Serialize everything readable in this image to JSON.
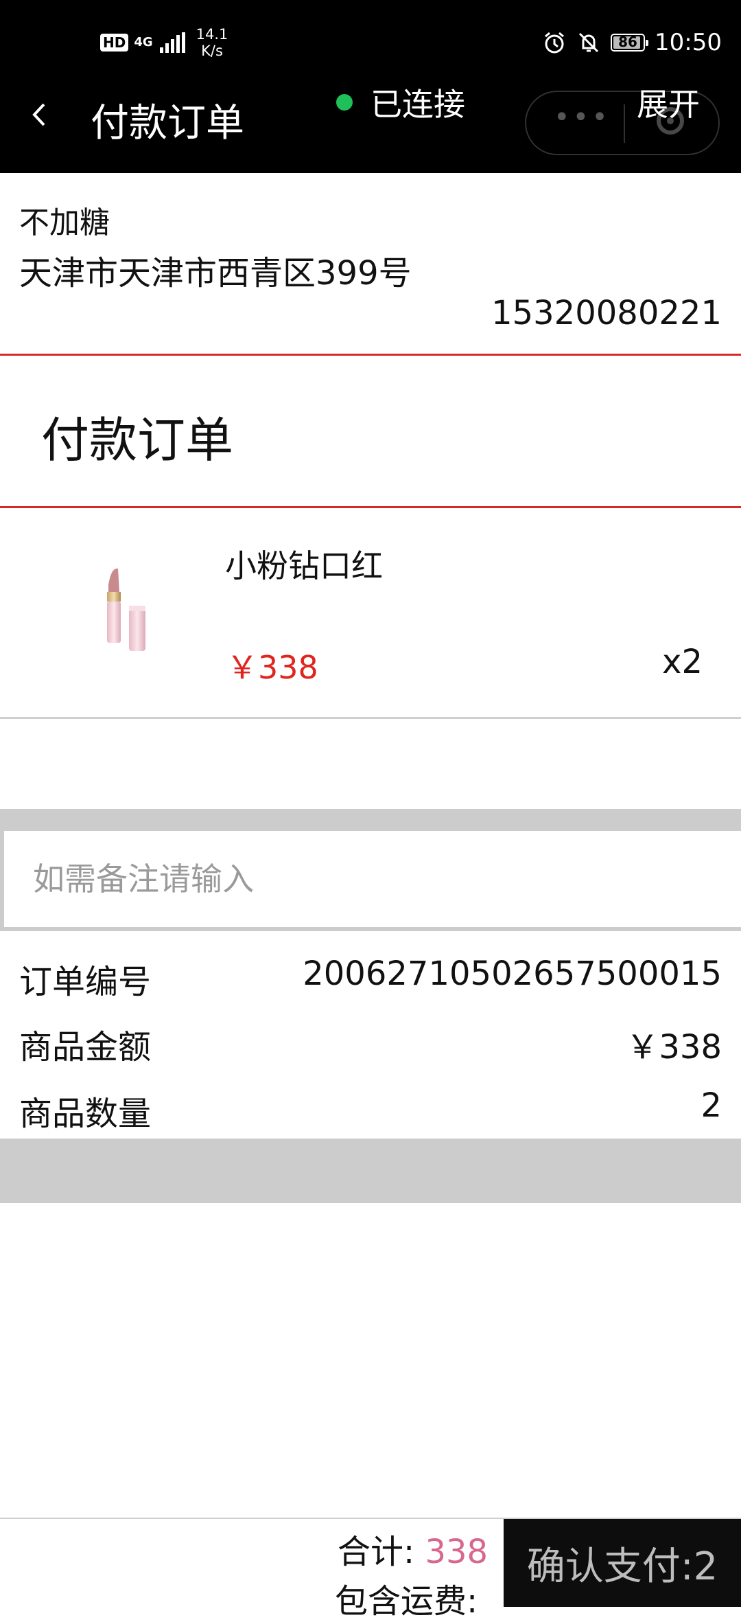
{
  "status_bar": {
    "hd": "HD",
    "network": "4G",
    "speed_value": "14.1",
    "speed_unit": "K/s",
    "battery": "86",
    "time": "10:50"
  },
  "header": {
    "title": "付款订单",
    "connection_status": "已连接",
    "expand_label": "展开",
    "colors": {
      "background": "#000000",
      "status_dot": "#1fbf5a"
    }
  },
  "address": {
    "name": "不加糖",
    "line": "天津市天津市西青区399号",
    "phone": "15320080221"
  },
  "section_title": "付款订单",
  "product": {
    "name": "小粉钻口红",
    "price": "￥338",
    "quantity": "x2",
    "image_icon": "lipstick-image",
    "price_color": "#e0251e"
  },
  "remark": {
    "placeholder": "如需备注请输入",
    "value": ""
  },
  "summary": [
    {
      "label": "订单编号",
      "value": "20062710502657500015"
    },
    {
      "label": "商品金额",
      "value": "￥338"
    },
    {
      "label": "商品数量",
      "value": "2"
    }
  ],
  "footer": {
    "total_label": "合计:",
    "total_value": "338",
    "shipping_label": "包含运费:",
    "pay_button": "确认支付:2",
    "total_color": "#d7688c"
  }
}
